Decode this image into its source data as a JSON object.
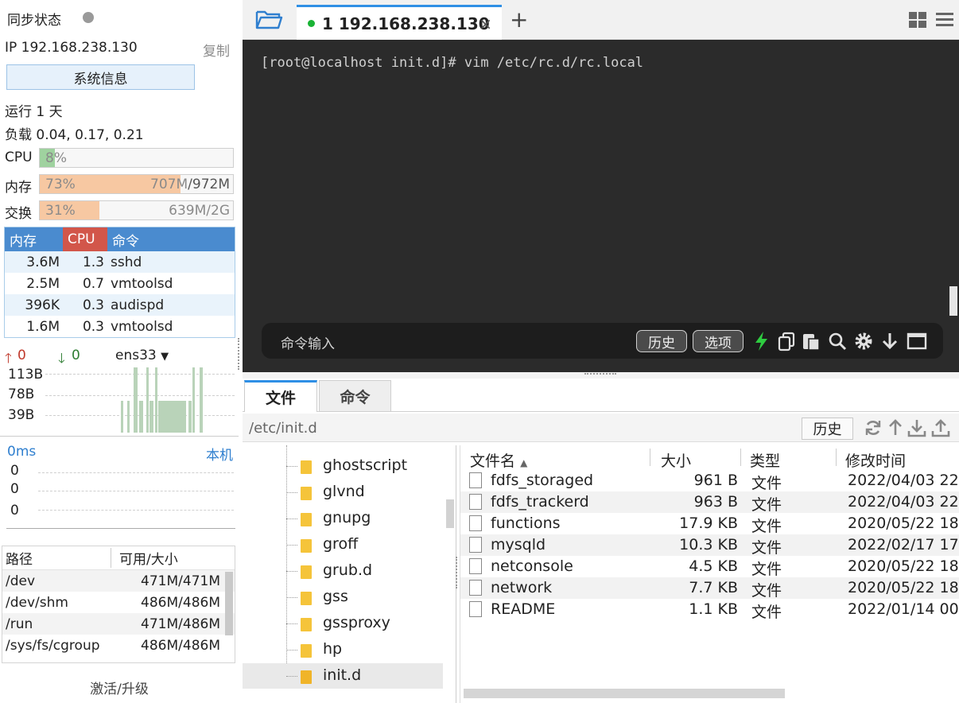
{
  "sidebar": {
    "sync_status": "同步状态",
    "ip_label": "IP 192.168.238.130",
    "copy_label": "复制",
    "sysinfo_button": "系统信息",
    "uptime": "运行 1 天",
    "load": "负载 0.04, 0.17, 0.21",
    "cpu": {
      "label": "CPU",
      "percent_text": "8%",
      "fraction": 0.08,
      "color": "#9fd29f"
    },
    "mem": {
      "label": "内存",
      "percent_text": "73%",
      "fraction": 0.73,
      "used": "707M",
      "total": "/972M",
      "color": "#f7c8a2"
    },
    "swap": {
      "label": "交换",
      "percent_text": "31%",
      "fraction": 0.31,
      "used": "639M/2G",
      "color": "#f7c8a2"
    },
    "process_table": {
      "headers": [
        "内存",
        "CPU",
        "命令"
      ],
      "rows": [
        {
          "mem": "3.6M",
          "cpu": "1.3",
          "cmd": "sshd"
        },
        {
          "mem": "2.5M",
          "cpu": "0.7",
          "cmd": "vmtoolsd"
        },
        {
          "mem": "396K",
          "cpu": "0.3",
          "cmd": "audispd"
        },
        {
          "mem": "1.6M",
          "cpu": "0.3",
          "cmd": "vmtoolsd"
        }
      ]
    },
    "network": {
      "up_value": "0",
      "down_value": "0",
      "interface": "ens33",
      "scale_labels": [
        "113B",
        "78B",
        "39B"
      ]
    },
    "latency": {
      "value_label": "0ms",
      "host_label": "本机",
      "values": [
        "0",
        "0",
        "0"
      ]
    },
    "disk_table": {
      "headers": [
        "路径",
        "可用/大小"
      ],
      "rows": [
        {
          "path": "/dev",
          "size": "471M/471M"
        },
        {
          "path": "/dev/shm",
          "size": "486M/486M"
        },
        {
          "path": "/run",
          "size": "471M/486M"
        },
        {
          "path": "/sys/fs/cgroup",
          "size": "486M/486M"
        }
      ]
    },
    "activate_label": "激活/升级"
  },
  "tabs": {
    "active_tab_label": "1 192.168.238.130",
    "close_glyph": "×",
    "add_glyph": "+"
  },
  "terminal": {
    "line": "[root@localhost init.d]# vim /etc/rc.d/rc.local",
    "command_placeholder": "命令输入",
    "history_button": "历史",
    "options_button": "选项"
  },
  "bottom_tabs": {
    "files": "文件",
    "commands": "命令"
  },
  "pathbar": {
    "path": "/etc/init.d",
    "history_button": "历史"
  },
  "tree": {
    "items": [
      "ghostscript",
      "glvnd",
      "gnupg",
      "groff",
      "grub.d",
      "gss",
      "gssproxy",
      "hp",
      "init.d"
    ],
    "selected": "init.d"
  },
  "files": {
    "headers": {
      "name": "文件名",
      "size": "大小",
      "type": "类型",
      "modified": "修改时间"
    },
    "rows": [
      {
        "name": "fdfs_storaged",
        "size": "961 B",
        "type": "文件",
        "modified": "2022/04/03 22"
      },
      {
        "name": "fdfs_trackerd",
        "size": "963 B",
        "type": "文件",
        "modified": "2022/04/03 22"
      },
      {
        "name": "functions",
        "size": "17.9 KB",
        "type": "文件",
        "modified": "2020/05/22 18"
      },
      {
        "name": "mysqld",
        "size": "10.3 KB",
        "type": "文件",
        "modified": "2022/02/17 17"
      },
      {
        "name": "netconsole",
        "size": "4.5 KB",
        "type": "文件",
        "modified": "2020/05/22 18"
      },
      {
        "name": "network",
        "size": "7.7 KB",
        "type": "文件",
        "modified": "2020/05/22 18"
      },
      {
        "name": "README",
        "size": "1.1 KB",
        "type": "文件",
        "modified": "2022/01/14 00"
      }
    ]
  }
}
